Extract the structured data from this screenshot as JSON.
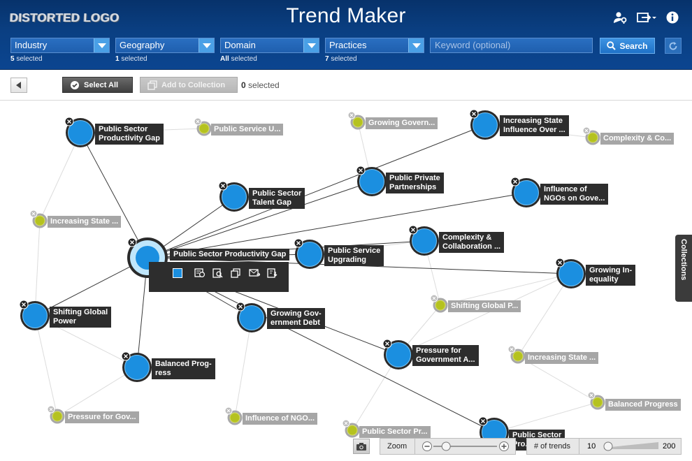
{
  "header": {
    "logo": "DISTORTED LOGO",
    "title": "Trend Maker"
  },
  "filters": [
    {
      "label": "Industry",
      "count": "5",
      "suffix": " selected"
    },
    {
      "label": "Geography",
      "count": "1",
      "suffix": " selected"
    },
    {
      "label": "Domain",
      "count": "All",
      "suffix": " selected"
    },
    {
      "label": "Practices",
      "count": "7",
      "suffix": " selected"
    }
  ],
  "search": {
    "placeholder": "Keyword (optional)",
    "button": "Search"
  },
  "toolbar": {
    "select_all": "Select All",
    "add_to_collection": "Add to Collection",
    "selected_count": "0",
    "selected_suffix": " selected"
  },
  "collections_tab": "Collections",
  "nodes": {
    "n1": "Public Sector\nProductivity Gap",
    "n2": "Public Sector Productivity Gap",
    "n3": "Public Sector\nTalent Gap",
    "n4": "Public Private\nPartnerships",
    "n5": "Increasing State\nInfluence Over ...",
    "n6": "Influence of\nNGOs on Gove...",
    "n7": "Complexity &\nCollaboration ...",
    "n8": "Public Service\nUpgrading",
    "n9": "Growing In-\nequality",
    "n10": "Shifting Global\nPower",
    "n11": "Growing Gov-\nernment Debt",
    "n12": "Pressure for\nGovernment A...",
    "n13": "Balanced Prog-\nress",
    "n14": "Public Sector\nPro..."
  },
  "minor_nodes": {
    "m1": "Public Service U...",
    "m2": "Growing Govern...",
    "m3": "Complexity & Co...",
    "m4": "Increasing State ...",
    "m5": "Shifting Global P...",
    "m6": "Increasing State ...",
    "m7": "Balanced Progress",
    "m8": "Pressure for Gov...",
    "m9": "Influence of NGO...",
    "m10": "Public Sector Pr..."
  },
  "bottom": {
    "zoom_label": "Zoom",
    "zoom_level": 0.2,
    "trends_label": "# of trends",
    "trends_min": "10",
    "trends_max": "200",
    "trends_value": 10
  },
  "colors": {
    "header": "#0a3f82",
    "node_blue": "#1b8fe0",
    "node_olive": "#b5c21f",
    "label_dark": "#2d2d2d",
    "label_grey": "#a6a6a6"
  },
  "icons": [
    "account-settings-icon",
    "export-icon",
    "info-icon",
    "search-icon",
    "refresh-icon",
    "checkmark-icon",
    "collection-icon",
    "camera-icon",
    "zoom-out-icon",
    "zoom-in-icon"
  ]
}
